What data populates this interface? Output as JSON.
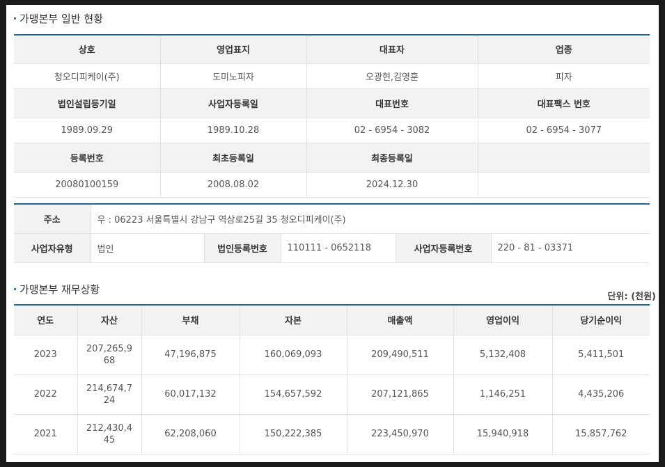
{
  "general": {
    "title": "가맹본부 일반 현황",
    "headers1": [
      "상호",
      "영업표지",
      "대표자",
      "업종"
    ],
    "values1": [
      "청오디피케이(주)",
      "도미노피자",
      "오광현,김영훈",
      "피자"
    ],
    "headers2": [
      "법인설립등기일",
      "사업자등록일",
      "대표번호",
      "대표팩스 번호"
    ],
    "values2": [
      "1989.09.29",
      "1989.10.28",
      "02 - 6954 - 3082",
      "02 - 6954 - 3077"
    ],
    "headers3": [
      "등록번호",
      "최초등록일",
      "최종등록일",
      ""
    ],
    "values3": [
      "20080100159",
      "2008.08.02",
      "2024.12.30",
      ""
    ]
  },
  "address": {
    "address_label": "주소",
    "address_value": "우 : 06223 서울특별시 강남구 역삼로25길 35 청오디피케이(주)",
    "biz_type_label": "사업자유형",
    "biz_type_value": "법인",
    "corp_no_label": "법인등록번호",
    "corp_no_value": "110111 - 0652118",
    "biz_no_label": "사업자등록번호",
    "biz_no_value": "220 - 81 - 03371"
  },
  "finance": {
    "title": "가맹본부 재무상황",
    "unit": "단위: (천원)",
    "headers": [
      "연도",
      "자산",
      "부채",
      "자본",
      "매출액",
      "영업이익",
      "당기순이익"
    ],
    "rows": [
      [
        "2023",
        "207,265,968",
        "47,196,875",
        "160,069,093",
        "209,490,511",
        "5,132,408",
        "5,411,501"
      ],
      [
        "2022",
        "214,674,724",
        "60,017,132",
        "154,657,592",
        "207,121,865",
        "1,146,251",
        "4,435,206"
      ],
      [
        "2021",
        "212,430,445",
        "62,208,060",
        "150,222,385",
        "223,450,970",
        "15,940,918",
        "15,857,762"
      ]
    ]
  }
}
